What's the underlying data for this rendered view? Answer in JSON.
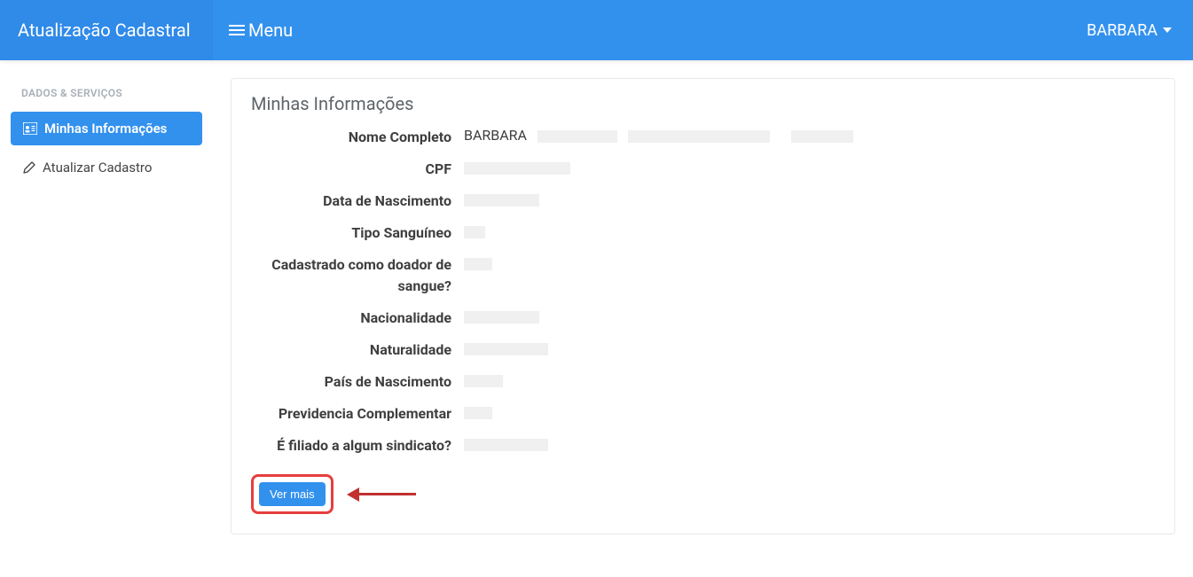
{
  "topbar": {
    "brand": "Atualização Cadastral",
    "menu_label": "Menu",
    "user_name": "BARBARA"
  },
  "sidebar": {
    "section_title": "DADOS & SERVIÇOS",
    "items": [
      {
        "label": "Minhas Informações",
        "icon": "id-card-icon",
        "active": true
      },
      {
        "label": "Atualizar Cadastro",
        "icon": "pen-icon",
        "active": false
      }
    ]
  },
  "card": {
    "title": "Minhas Informações",
    "rows": [
      {
        "label": "Nome Completo",
        "value": "BARBARA"
      },
      {
        "label": "CPF",
        "value": ""
      },
      {
        "label": "Data de Nascimento",
        "value": ""
      },
      {
        "label": "Tipo Sanguíneo",
        "value": ""
      },
      {
        "label": "Cadastrado como doador de sangue?",
        "value": ""
      },
      {
        "label": "Nacionalidade",
        "value": ""
      },
      {
        "label": "Naturalidade",
        "value": ""
      },
      {
        "label": "País de Nascimento",
        "value": ""
      },
      {
        "label": "Previdencia Complementar",
        "value": ""
      },
      {
        "label": "É filiado a algum sindicato?",
        "value": ""
      }
    ],
    "see_more_label": "Ver mais"
  }
}
